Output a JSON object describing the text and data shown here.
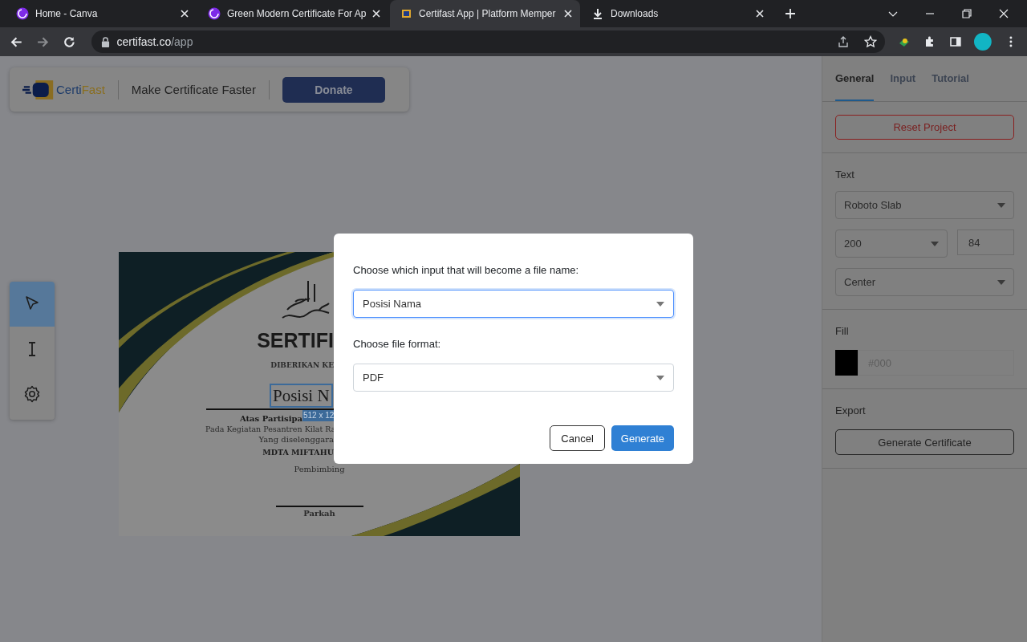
{
  "browser": {
    "tabs": [
      {
        "title": "Home - Canva",
        "kind": "site",
        "selected": false
      },
      {
        "title": "Green Modern Certificate For Ap",
        "kind": "site",
        "selected": false
      },
      {
        "title": "Certifast App | Platform Memper",
        "kind": "app",
        "selected": true
      },
      {
        "title": "Downloads",
        "kind": "download",
        "selected": false
      }
    ],
    "address": {
      "host": "certifast.co",
      "path": "/app"
    }
  },
  "header": {
    "logo": {
      "first": "Certi",
      "second": "Fast"
    },
    "tagline": "Make Certificate Faster",
    "donate": "Donate"
  },
  "tools": [
    {
      "kind": "pointer",
      "selected": true
    },
    {
      "kind": "text",
      "selected": false
    },
    {
      "kind": "settings",
      "selected": false
    }
  ],
  "certificate": {
    "title": "SERTIFI",
    "given_to": "DIBERIKAN KE",
    "name": "Posisi N",
    "size_label": "512 x 12",
    "lines": [
      {
        "text": "Atas Partisipa",
        "bold": true
      },
      {
        "text": "Pada Kegiatan Pesantren Kilat Ra",
        "bold": false
      },
      {
        "text": "Yang diselenggara",
        "bold": false
      },
      {
        "text": "MDTA MIFTAHU",
        "bold": true
      }
    ],
    "role": "Pembimbing",
    "signer": "Parkah"
  },
  "panel": {
    "tabs": [
      {
        "label": "General",
        "selected": true
      },
      {
        "label": "Input",
        "selected": false
      },
      {
        "label": "Tutorial",
        "selected": false
      }
    ],
    "reset": "Reset Project",
    "text_heading": "Text",
    "font": "Roboto Slab",
    "weight": "200",
    "size": "84",
    "align": "Center",
    "fill_heading": "Fill",
    "fill_placeholder": "#000",
    "export_heading": "Export",
    "generate": "Generate Certificate"
  },
  "dialog": {
    "filename_label": "Choose which input that will become a file name:",
    "filename_value": "Posisi Nama",
    "format_label": "Choose file format:",
    "format_value": "PDF",
    "cancel": "Cancel",
    "generate": "Generate"
  }
}
